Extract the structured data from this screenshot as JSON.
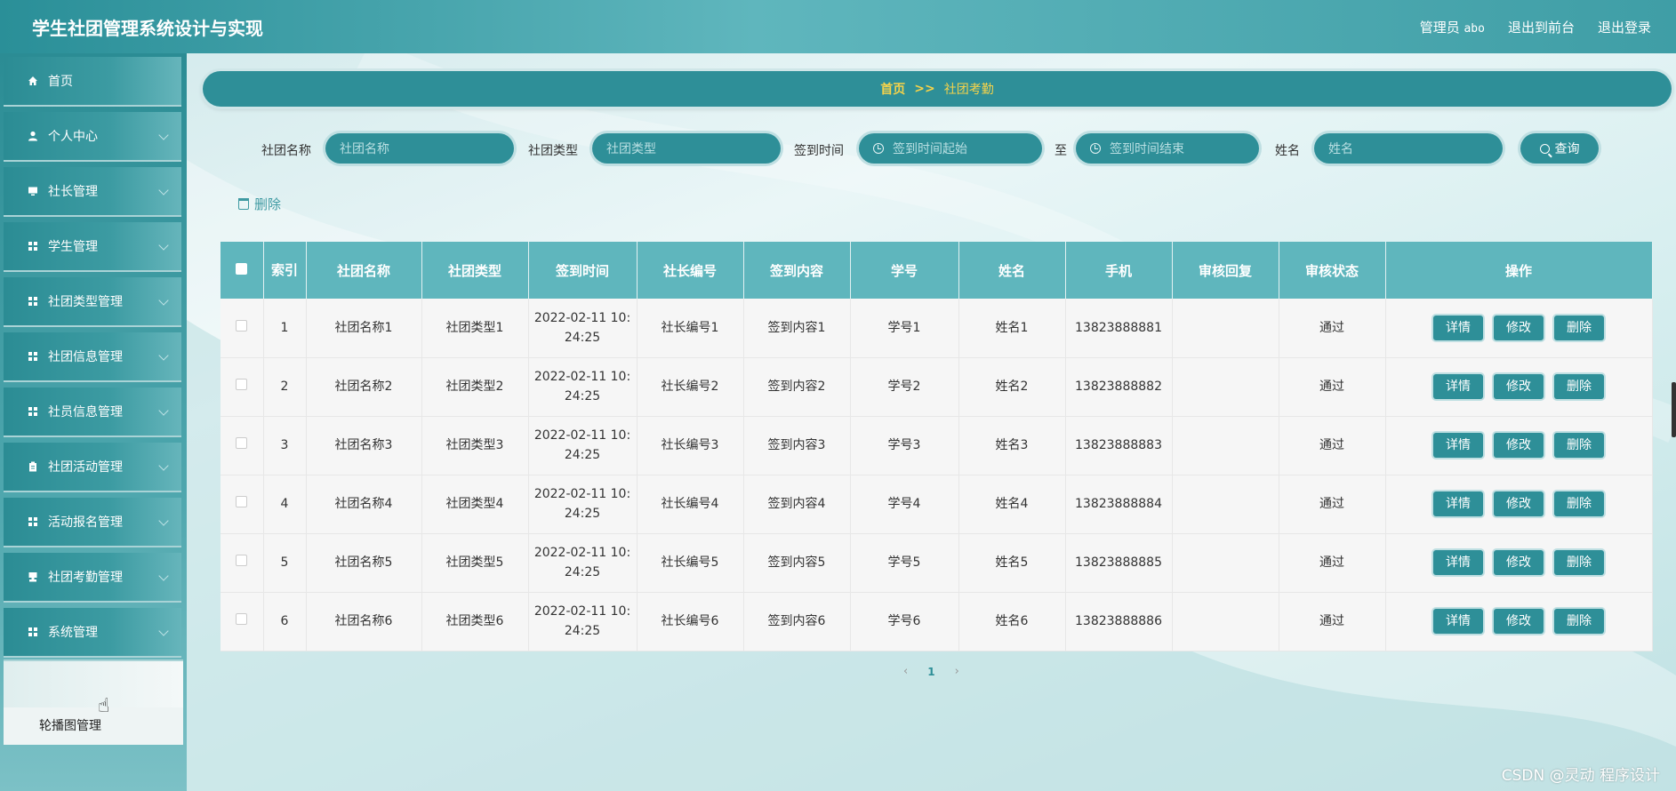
{
  "header": {
    "title": "学生社团管理系统设计与实现",
    "admin_label": "管理员",
    "admin_name": "abo",
    "front_link": "退出到前台",
    "logout_link": "退出登录"
  },
  "sidebar": {
    "items": [
      {
        "label": "首页",
        "icon": "home-icon"
      },
      {
        "label": "个人中心",
        "icon": "user-icon"
      },
      {
        "label": "社长管理",
        "icon": "monitor-icon"
      },
      {
        "label": "学生管理",
        "icon": "grid-icon"
      },
      {
        "label": "社团类型管理",
        "icon": "grid-icon"
      },
      {
        "label": "社团信息管理",
        "icon": "grid-icon"
      },
      {
        "label": "社员信息管理",
        "icon": "grid-icon"
      },
      {
        "label": "社团活动管理",
        "icon": "clipboard-icon"
      },
      {
        "label": "活动报名管理",
        "icon": "grid-icon"
      },
      {
        "label": "社团考勤管理",
        "icon": "stamp-icon"
      },
      {
        "label": "系统管理",
        "icon": "grid-icon"
      }
    ],
    "last_item": "轮播图管理"
  },
  "breadcrumb": {
    "home": "首页",
    "separator": ">>",
    "current": "社团考勤"
  },
  "search": {
    "club_name_label": "社团名称",
    "club_name_placeholder": "社团名称",
    "club_type_label": "社团类型",
    "club_type_placeholder": "社团类型",
    "time_label": "签到时间",
    "time_start_placeholder": "签到时间起始",
    "to_label": "至",
    "time_end_placeholder": "签到时间结束",
    "name_label": "姓名",
    "name_placeholder": "姓名",
    "query_button": "查询"
  },
  "toolbar": {
    "delete_label": "删除"
  },
  "table": {
    "headers": [
      "索引",
      "社团名称",
      "社团类型",
      "签到时间",
      "社长编号",
      "签到内容",
      "学号",
      "姓名",
      "手机",
      "审核回复",
      "审核状态",
      "操作"
    ],
    "rows": [
      {
        "index": "1",
        "club_name": "社团名称1",
        "club_type": "社团类型1",
        "time_line1": "2022-02-11 10:",
        "time_line2": "24:25",
        "leader_no": "社长编号1",
        "content": "签到内容1",
        "student_no": "学号1",
        "name": "姓名1",
        "phone": "13823888881",
        "reply": "",
        "status": "通过"
      },
      {
        "index": "2",
        "club_name": "社团名称2",
        "club_type": "社团类型2",
        "time_line1": "2022-02-11 10:",
        "time_line2": "24:25",
        "leader_no": "社长编号2",
        "content": "签到内容2",
        "student_no": "学号2",
        "name": "姓名2",
        "phone": "13823888882",
        "reply": "",
        "status": "通过"
      },
      {
        "index": "3",
        "club_name": "社团名称3",
        "club_type": "社团类型3",
        "time_line1": "2022-02-11 10:",
        "time_line2": "24:25",
        "leader_no": "社长编号3",
        "content": "签到内容3",
        "student_no": "学号3",
        "name": "姓名3",
        "phone": "13823888883",
        "reply": "",
        "status": "通过"
      },
      {
        "index": "4",
        "club_name": "社团名称4",
        "club_type": "社团类型4",
        "time_line1": "2022-02-11 10:",
        "time_line2": "24:25",
        "leader_no": "社长编号4",
        "content": "签到内容4",
        "student_no": "学号4",
        "name": "姓名4",
        "phone": "13823888884",
        "reply": "",
        "status": "通过"
      },
      {
        "index": "5",
        "club_name": "社团名称5",
        "club_type": "社团类型5",
        "time_line1": "2022-02-11 10:",
        "time_line2": "24:25",
        "leader_no": "社长编号5",
        "content": "签到内容5",
        "student_no": "学号5",
        "name": "姓名5",
        "phone": "13823888885",
        "reply": "",
        "status": "通过"
      },
      {
        "index": "6",
        "club_name": "社团名称6",
        "club_type": "社团类型6",
        "time_line1": "2022-02-11 10:",
        "time_line2": "24:25",
        "leader_no": "社长编号6",
        "content": "签到内容6",
        "student_no": "学号6",
        "name": "姓名6",
        "phone": "13823888886",
        "reply": "",
        "status": "通过"
      }
    ],
    "actions": {
      "detail": "详情",
      "edit": "修改",
      "delete": "删除"
    }
  },
  "pagination": {
    "prev": "‹",
    "current_page": "1",
    "next": "›"
  },
  "watermark": "CSDN @灵动 程序设计",
  "colors": {
    "primary": "#2e8f98",
    "header_row": "#5fb6bd",
    "breadcrumb_text": "#f5d34a"
  }
}
